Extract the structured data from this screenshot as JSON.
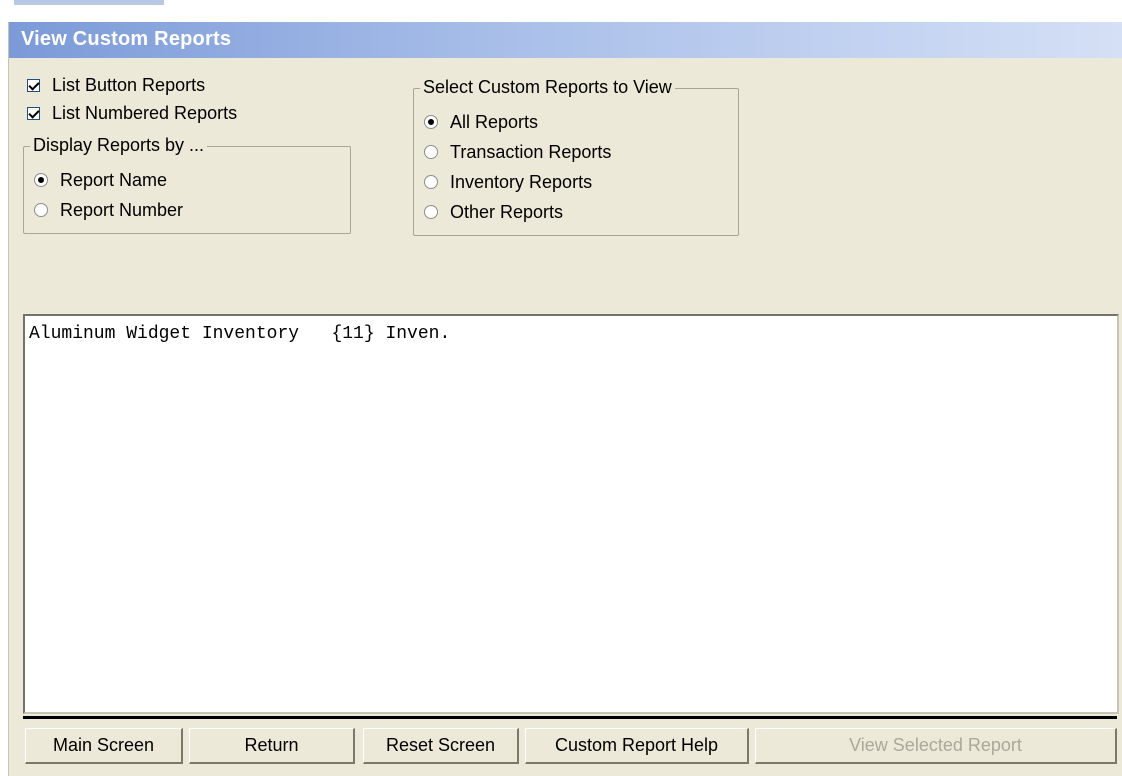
{
  "window": {
    "title": "View Custom Reports"
  },
  "options": {
    "list_button_reports": {
      "label": "List Button Reports",
      "checked": true
    },
    "list_numbered_reports": {
      "label": "List Numbered Reports",
      "checked": true
    }
  },
  "display_by": {
    "legend": "Display Reports by ...",
    "options": [
      {
        "label": "Report Name",
        "selected": true
      },
      {
        "label": "Report Number",
        "selected": false
      }
    ]
  },
  "select_reports": {
    "legend": "Select Custom Reports to View",
    "options": [
      {
        "label": "All Reports",
        "selected": true
      },
      {
        "label": "Transaction Reports",
        "selected": false
      },
      {
        "label": "Inventory Reports",
        "selected": false
      },
      {
        "label": "Other Reports",
        "selected": false
      }
    ]
  },
  "report_list": {
    "items": [
      "Aluminum Widget Inventory   {11} Inven."
    ]
  },
  "buttons": {
    "main_screen": "Main Screen",
    "return": "Return",
    "reset_screen": "Reset Screen",
    "custom_report_help": "Custom Report Help",
    "view_selected_report": "View Selected Report"
  }
}
